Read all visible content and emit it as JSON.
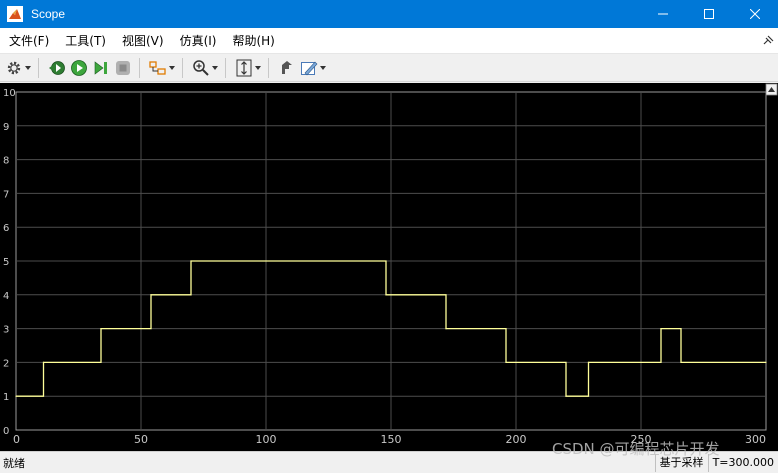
{
  "window": {
    "title": "Scope",
    "titlebar_color": "#0078d7",
    "buttons": [
      "minimize-icon",
      "maximize-icon",
      "close-icon"
    ]
  },
  "menu": {
    "items": [
      "文件(F)",
      "工具(T)",
      "视图(V)",
      "仿真(I)",
      "帮助(H)"
    ]
  },
  "toolbar": {
    "icons": [
      "gear-icon",
      "step-back-icon",
      "run-icon",
      "step-forward-icon",
      "stop-icon",
      "highlight-block-icon",
      "zoom-in-icon",
      "scale-axes-icon",
      "pin-icon",
      "style-icon"
    ]
  },
  "status": {
    "left": "就绪",
    "mode": "基于采样",
    "time": "T=300.000"
  },
  "watermark": "CSDN @可编程芯片开发",
  "chart_data": {
    "type": "line",
    "step": true,
    "background": "#000000",
    "line_color": "#ffff99",
    "grid": true,
    "grid_color": "#4d4d4d",
    "xlim": [
      0,
      300
    ],
    "ylim": [
      0,
      10
    ],
    "xticks": [
      0,
      50,
      100,
      150,
      200,
      250,
      300
    ],
    "yticks": [
      0,
      1,
      2,
      3,
      4,
      5,
      6,
      7,
      8,
      9,
      10
    ],
    "x": [
      0,
      11,
      34,
      54,
      70,
      148,
      172,
      196,
      220,
      229,
      258,
      266,
      300
    ],
    "y": [
      1,
      2,
      3,
      4,
      5,
      4,
      3,
      2,
      1,
      2,
      3,
      2,
      2
    ]
  }
}
